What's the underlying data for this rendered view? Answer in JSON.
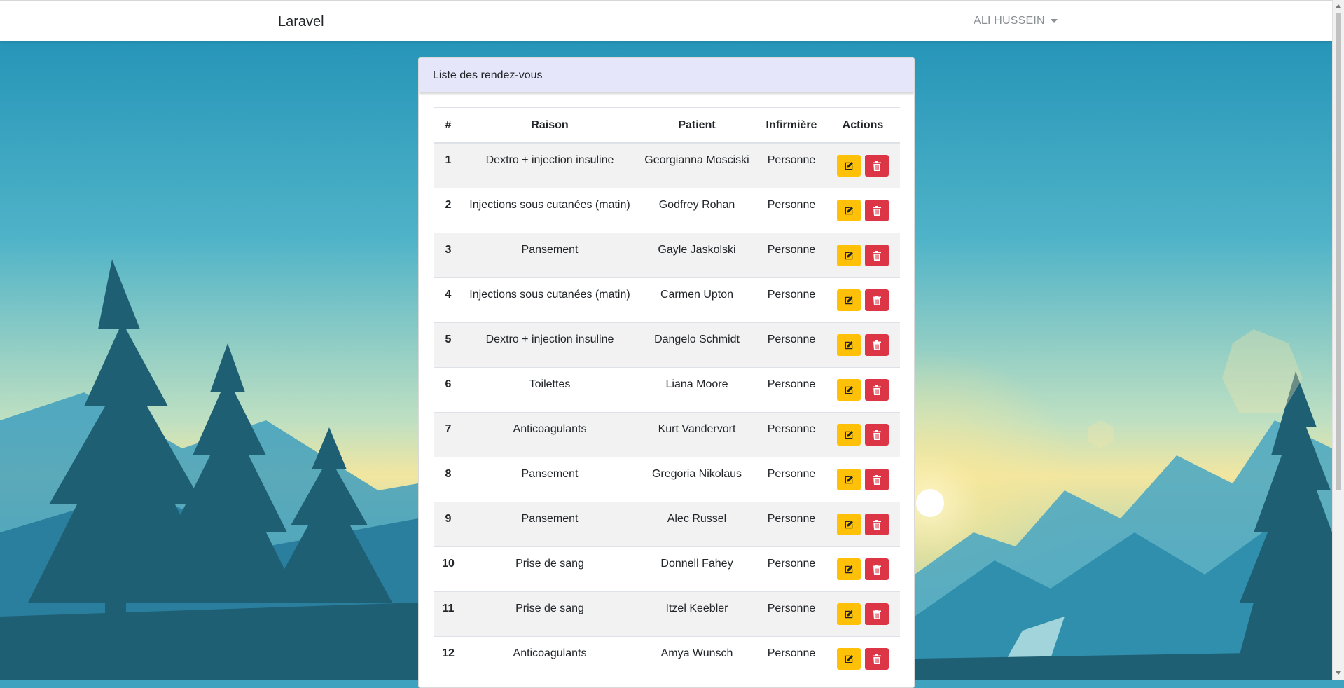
{
  "navbar": {
    "brand": "Laravel",
    "user_name": "ALI HUSSEIN"
  },
  "card": {
    "title": "Liste des rendez-vous"
  },
  "table": {
    "headers": {
      "num": "#",
      "raison": "Raison",
      "patient": "Patient",
      "infirmiere": "Infirmière",
      "actions": "Actions"
    },
    "rows": [
      {
        "id": "1",
        "raison": "Dextro + injection insuline",
        "patient": "Georgianna Mosciski",
        "infirmiere": "Personne"
      },
      {
        "id": "2",
        "raison": "Injections sous cutanées (matin)",
        "patient": "Godfrey Rohan",
        "infirmiere": "Personne"
      },
      {
        "id": "3",
        "raison": "Pansement",
        "patient": "Gayle Jaskolski",
        "infirmiere": "Personne"
      },
      {
        "id": "4",
        "raison": "Injections sous cutanées (matin)",
        "patient": "Carmen Upton",
        "infirmiere": "Personne"
      },
      {
        "id": "5",
        "raison": "Dextro + injection insuline",
        "patient": "Dangelo Schmidt",
        "infirmiere": "Personne"
      },
      {
        "id": "6",
        "raison": "Toilettes",
        "patient": "Liana Moore",
        "infirmiere": "Personne"
      },
      {
        "id": "7",
        "raison": "Anticoagulants",
        "patient": "Kurt Vandervort",
        "infirmiere": "Personne"
      },
      {
        "id": "8",
        "raison": "Pansement",
        "patient": "Gregoria Nikolaus",
        "infirmiere": "Personne"
      },
      {
        "id": "9",
        "raison": "Pansement",
        "patient": "Alec Russel",
        "infirmiere": "Personne"
      },
      {
        "id": "10",
        "raison": "Prise de sang",
        "patient": "Donnell Fahey",
        "infirmiere": "Personne"
      },
      {
        "id": "11",
        "raison": "Prise de sang",
        "patient": "Itzel Keebler",
        "infirmiere": "Personne"
      },
      {
        "id": "12",
        "raison": "Anticoagulants",
        "patient": "Amya Wunsch",
        "infirmiere": "Personne"
      }
    ]
  },
  "icons": {
    "edit": "edit-icon",
    "delete": "trash-icon",
    "user_menu": "caret-down-icon"
  },
  "colors": {
    "card_header_bg": "#e6e6fa",
    "edit_button": "#ffc107",
    "delete_button": "#dc3545"
  }
}
